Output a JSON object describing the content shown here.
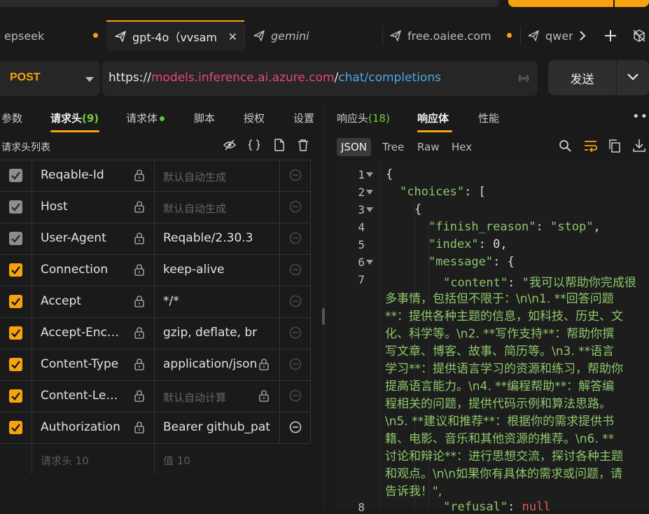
{
  "tabs": [
    {
      "label": "epseek",
      "state": "unsaved"
    },
    {
      "label": "gpt-4o（vvsam",
      "state": "active"
    },
    {
      "label": "gemini",
      "state": "preview"
    },
    {
      "label": "free.oaiee.com",
      "state": "unsaved"
    },
    {
      "label": "qwen",
      "state": "clipped"
    }
  ],
  "request": {
    "method": "POST",
    "url": {
      "scheme": "https://",
      "host": "models.inference.ai.azure.com",
      "slash": "/",
      "path": "chat/completions"
    },
    "send_label": "发送"
  },
  "left_tabs": {
    "params": "参数",
    "headers": "请求头",
    "headers_count": "(9)",
    "body": "请求体",
    "script": "脚本",
    "auth": "授权",
    "settings": "设置"
  },
  "headers_title": "请求头列表",
  "headers": [
    {
      "name": "Reqable-Id",
      "value": "默认自动生成",
      "checked": "grey",
      "auto": true
    },
    {
      "name": "Host",
      "value": "默认自动生成",
      "checked": "grey",
      "auto": true
    },
    {
      "name": "User-Agent",
      "value": "Reqable/2.30.3",
      "checked": "grey",
      "auto": false
    },
    {
      "name": "Connection",
      "value": "keep-alive",
      "checked": "orange",
      "auto": false
    },
    {
      "name": "Accept",
      "value": "*/*",
      "checked": "orange",
      "auto": false
    },
    {
      "name": "Accept-Encoding",
      "value": "gzip, deflate, br",
      "checked": "orange",
      "auto": false
    },
    {
      "name": "Content-Type",
      "value": "application/json",
      "checked": "orange",
      "auto": false
    },
    {
      "name": "Content-Length",
      "value": "默认自动计算",
      "checked": "orange",
      "auto": true
    },
    {
      "name": "Authorization",
      "value": "Bearer github_pat",
      "checked": "orange",
      "auto": false
    }
  ],
  "new_header": {
    "name_placeholder": "请求头 10",
    "value_placeholder": "值 10"
  },
  "right_tabs": {
    "resp_headers": "响应头",
    "resp_headers_count": "(18)",
    "resp_body": "响应体",
    "perf": "性能"
  },
  "formats": [
    "JSON",
    "Tree",
    "Raw",
    "Hex"
  ],
  "code": {
    "lines": [
      {
        "n": "1",
        "text": "{"
      },
      {
        "n": "2",
        "key": "\"choices\"",
        "rest": ": ["
      },
      {
        "n": "3",
        "text": "{"
      },
      {
        "n": "4",
        "key": "\"finish_reason\"",
        "rest": ": ",
        "val": "\"stop\"",
        "tail": ","
      },
      {
        "n": "5",
        "key": "\"index\"",
        "rest": ": ",
        "num": "0",
        "tail": ","
      },
      {
        "n": "6",
        "key": "\"message\"",
        "rest": ": {"
      },
      {
        "n": "7",
        "key": "\"content\"",
        "rest": ": ",
        "val": "\"我可以帮助你完成很"
      },
      {
        "n": "8",
        "key": "\"refusal\"",
        "rest": ": ",
        "nul": "null"
      }
    ],
    "content_wrap": [
      "多事情，包括但不限于：\\n\\n1. **回答问题",
      "**：提供各种主题的信息，如科技、历史、文",
      "化、科学等。\\n2. **写作支持**：帮助你撰",
      "写文章、博客、故事、简历等。\\n3. **语言",
      "学习**：提供语言学习的资源和练习，帮助你",
      "提高语言能力。\\n4. **编程帮助**：解答编",
      "程相关的问题，提供代码示例和算法思路。",
      "\\n5. **建议和推荐**：根据你的需求提供书",
      "籍、电影、音乐和其他资源的推荐。\\n6. **",
      "讨论和辩论**：进行思想交流，探讨各种主题",
      "和观点。\\n\\n如果你有具体的需求或问题，请",
      "告诉我！\","
    ]
  },
  "colors": {
    "accent": "#f6a30f",
    "host": "#e8457a",
    "path": "#4ea7e6",
    "count": "#6fcf3f",
    "json_string": "#8ec66a"
  }
}
